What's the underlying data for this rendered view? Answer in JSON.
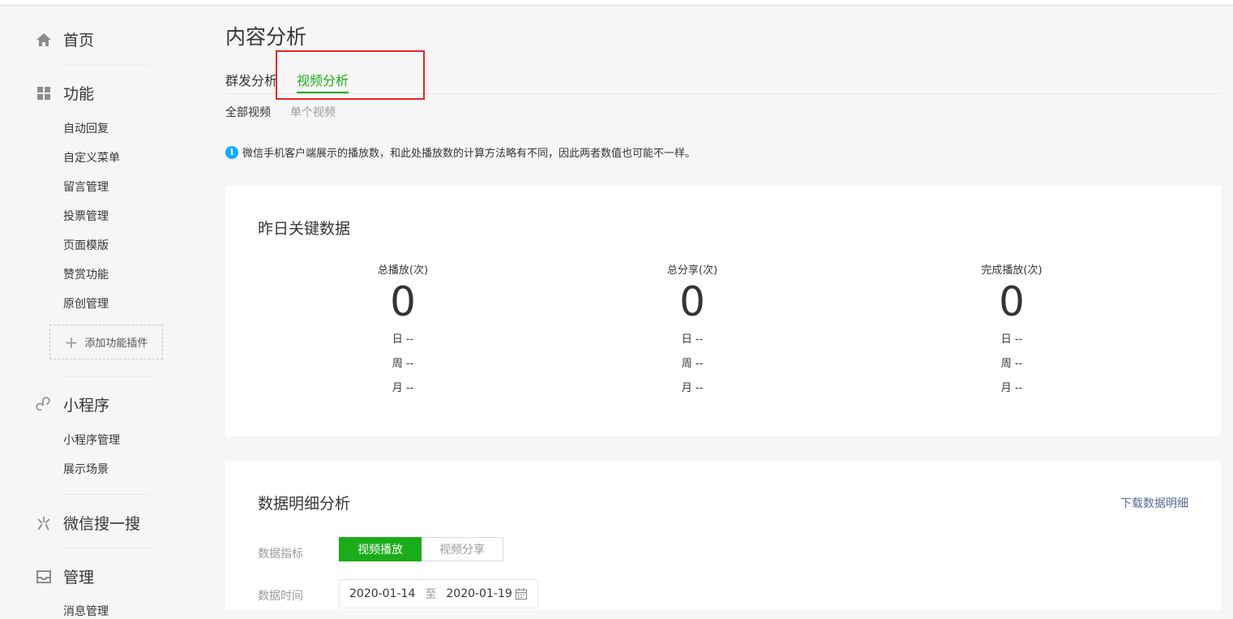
{
  "sidebar": {
    "home": "首页",
    "features": "功能",
    "feature_items": [
      "自动回复",
      "自定义菜单",
      "留言管理",
      "投票管理",
      "页面模版",
      "赞赏功能",
      "原创管理"
    ],
    "add_plugin": "添加功能插件",
    "miniprogram": "小程序",
    "miniprogram_items": [
      "小程序管理",
      "展示场景"
    ],
    "wechat_search": "微信搜一搜",
    "manage": "管理",
    "manage_items": [
      "消息管理"
    ]
  },
  "main": {
    "title": "内容分析",
    "tabs": [
      {
        "label": "群发分析",
        "active": false
      },
      {
        "label": "视频分析",
        "active": true
      }
    ],
    "subtabs": [
      {
        "label": "全部视频",
        "active": true
      },
      {
        "label": "单个视频",
        "active": false
      }
    ],
    "notice": "微信手机客户端展示的播放数，和此处播放数的计算方法略有不同，因此两者数值也可能不一样。"
  },
  "key_data": {
    "title": "昨日关键数据",
    "metrics": [
      {
        "label": "总播放(次)",
        "value": "0",
        "day": "日 --",
        "week": "周 --",
        "month": "月 --"
      },
      {
        "label": "总分享(次)",
        "value": "0",
        "day": "日 --",
        "week": "周 --",
        "month": "月 --"
      },
      {
        "label": "完成播放(次)",
        "value": "0",
        "day": "日 --",
        "week": "周 --",
        "month": "月 --"
      }
    ]
  },
  "detail": {
    "title": "数据明细分析",
    "download": "下载数据明细",
    "metric_label": "数据指标",
    "metric_options": [
      {
        "label": "视频播放",
        "active": true
      },
      {
        "label": "视频分享",
        "active": false
      }
    ],
    "time_label": "数据时间",
    "date_start": "2020-01-14",
    "date_sep": "至",
    "date_end": "2020-01-19"
  },
  "colors": {
    "accent": "#1aad19",
    "highlight": "#e5262b",
    "link": "#576b95",
    "info": "#10aeff"
  }
}
